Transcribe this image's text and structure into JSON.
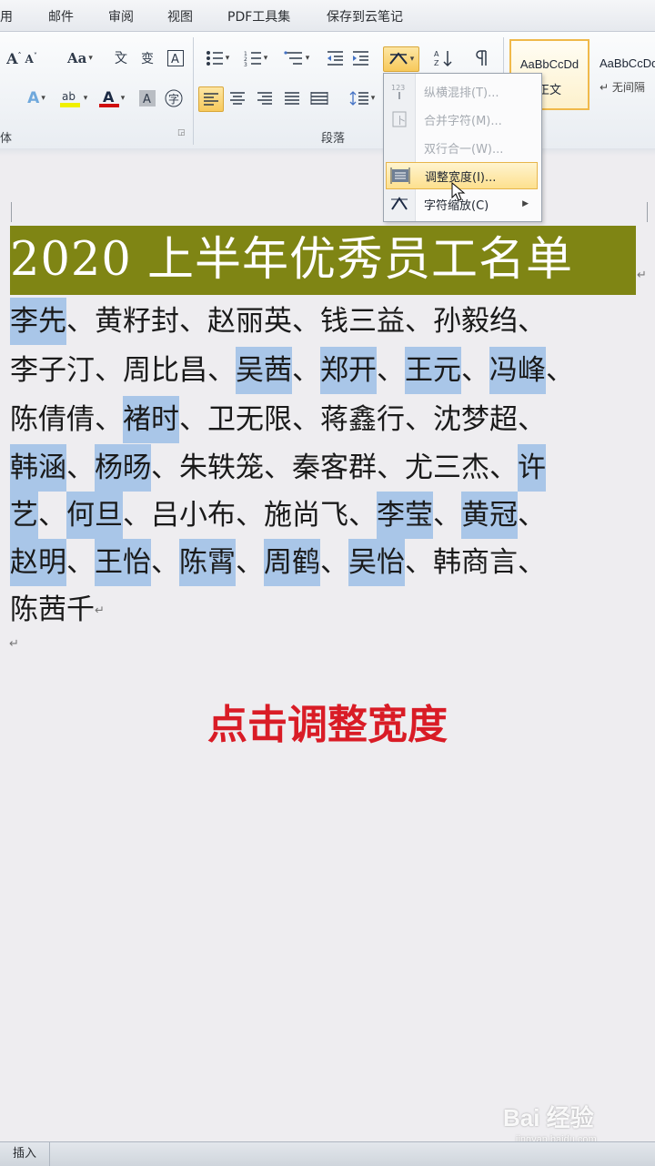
{
  "ribbon_tabs": [
    "用",
    "邮件",
    "审阅",
    "视图",
    "PDF工具集",
    "保存到云笔记"
  ],
  "ribbon": {
    "group_font_partial": "体",
    "group_paragraph": "段落",
    "styles": [
      {
        "sample": "AaBbCcDd",
        "name": "正文"
      },
      {
        "sample": "AaBbCcDd",
        "name": "↵ 无间隔"
      }
    ]
  },
  "menu": {
    "items": [
      {
        "label": "纵横混排(T)...",
        "enabled": false,
        "highlighted": false,
        "icon": "vertical-text-icon"
      },
      {
        "label": "合并字符(M)...",
        "enabled": false,
        "highlighted": false,
        "icon": "combine-characters-icon"
      },
      {
        "label": "双行合一(W)...",
        "enabled": false,
        "highlighted": false,
        "icon": "two-lines-in-one-icon"
      },
      {
        "label": "调整宽度(I)...",
        "enabled": true,
        "highlighted": true,
        "icon": "adjust-width-icon"
      },
      {
        "label": "字符缩放(C)",
        "enabled": true,
        "highlighted": false,
        "icon": "character-scale-icon",
        "has_submenu": true
      }
    ]
  },
  "document": {
    "title": "2020 上半年优秀员工名单",
    "lines": [
      {
        "names": [
          "李先",
          "黄籽封",
          "赵丽英",
          "钱三益",
          "孙毅绉"
        ],
        "highlighted": [
          true,
          false,
          false,
          false,
          false
        ],
        "trailing_sep": true
      },
      {
        "names": [
          "李子汀",
          "周比昌",
          "吴茜",
          "郑开",
          "王元",
          "冯峰"
        ],
        "highlighted": [
          false,
          false,
          true,
          true,
          true,
          true
        ],
        "trailing_sep": true
      },
      {
        "names": [
          "陈倩倩",
          "褚时",
          "卫无限",
          "蒋鑫行",
          "沈梦超"
        ],
        "highlighted": [
          false,
          true,
          false,
          false,
          false
        ],
        "trailing_sep": true
      },
      {
        "names": [
          "韩涵",
          "杨旸",
          "朱轶笼",
          "秦客群",
          "尤三杰",
          "许"
        ],
        "highlighted": [
          true,
          true,
          false,
          false,
          false,
          true
        ],
        "trailing_sep": false
      },
      {
        "names": [
          "艺",
          "何旦",
          "吕小布",
          "施尚飞",
          "李莹",
          "黄冠"
        ],
        "highlighted": [
          true,
          true,
          false,
          false,
          true,
          true
        ],
        "trailing_sep": true
      },
      {
        "names": [
          "赵明",
          "王怡",
          "陈霄",
          "周鹤",
          "吴怡",
          "韩商言"
        ],
        "highlighted": [
          true,
          true,
          true,
          true,
          true,
          false
        ],
        "trailing_sep": true
      },
      {
        "names": [
          "陈茜千"
        ],
        "highlighted": [
          false
        ],
        "trailing_sep": false
      }
    ],
    "paragraph_mark": "↵",
    "separator": "、",
    "highlight_color": "#a9c6e8",
    "title_bg_color": "#7f8514"
  },
  "caption": "点击调整宽度",
  "status_bar": {
    "mode": "插入"
  },
  "watermark": {
    "brand": "Bai 经验",
    "url": "jingyan.baidu.com"
  }
}
